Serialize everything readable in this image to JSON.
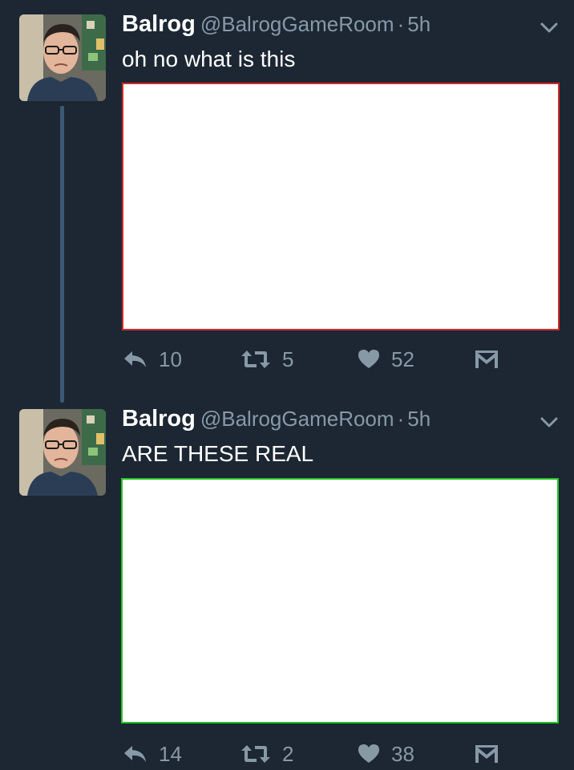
{
  "tweets": [
    {
      "display_name": "Balrog",
      "handle": "@BalrogGameRoom",
      "separator": "·",
      "time": "5h",
      "text": "oh no what is this",
      "replies": "10",
      "retweets": "5",
      "likes": "52",
      "media_border_color": "#d12a2a"
    },
    {
      "display_name": "Balrog",
      "handle": "@BalrogGameRoom",
      "separator": "·",
      "time": "5h",
      "text": "ARE THESE REAL",
      "replies": "14",
      "retweets": "2",
      "likes": "38",
      "media_border_color": "#22c522"
    }
  ],
  "icons": {
    "reply": "reply-icon",
    "retweet": "retweet-icon",
    "like": "heart-icon",
    "dm": "envelope-icon",
    "caret": "chevron-down-icon"
  },
  "colors": {
    "background": "#1c2733",
    "secondary_text": "#8899a6",
    "thread_line": "#3c5a73"
  }
}
